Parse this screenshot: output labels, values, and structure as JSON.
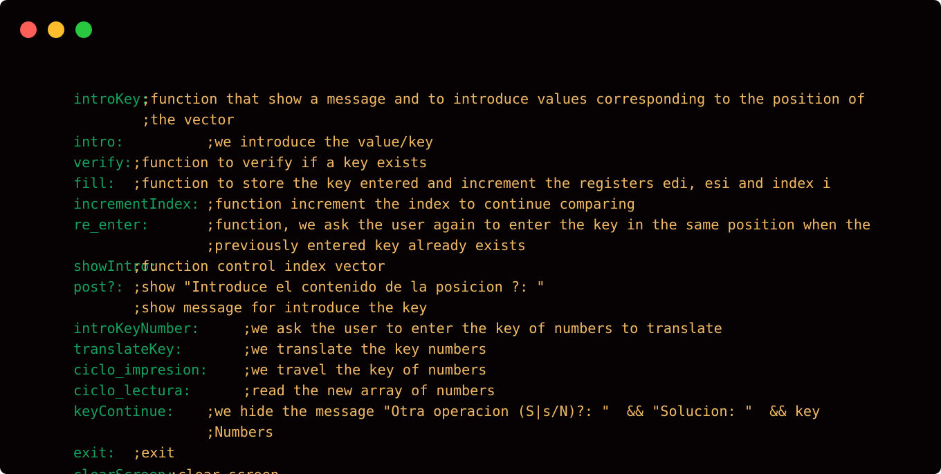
{
  "window": {
    "colors": {
      "background": "#060203",
      "label": "#14a05f",
      "comment": "#f0b864",
      "close": "#ff5f58",
      "minimize": "#ffbd2e",
      "maximize": "#28c940"
    }
  },
  "code": {
    "lines": [
      {
        "label": "introKey:",
        "comment": ";function that show a message and to introduce values corresponding to the position of"
      },
      {
        "label": "",
        "comment": ";the vector"
      },
      {
        "label": "intro:",
        "comment": ";we introduce the value/key"
      },
      {
        "label": "verify:",
        "comment": ";function to verify if a key exists"
      },
      {
        "label": "fill:",
        "comment": ";function to store the key entered and increment the registers edi, esi and index i"
      },
      {
        "label": "incrementIndex:",
        "comment": ";function increment the index to continue comparing"
      },
      {
        "label": "re_enter:",
        "comment": ";function, we ask the user again to enter the key in the same position when the"
      },
      {
        "label": "",
        "comment": ";previously entered key already exists"
      },
      {
        "label": "showIntro:",
        "comment": ";function control index vector"
      },
      {
        "label": "post?:",
        "comment": ";show \"Introduce el contenido de la posicion ?: \""
      },
      {
        "label": "",
        "comment": ";show message for introduce the key"
      },
      {
        "label": "introKeyNumber:",
        "comment": ";we ask the user to enter the key of numbers to translate"
      },
      {
        "label": "translateKey:",
        "comment": ";we translate the key numbers"
      },
      {
        "label": "ciclo_impresion:",
        "comment": ";we travel the key of numbers"
      },
      {
        "label": "ciclo_lectura:",
        "comment": ";read the new array of numbers"
      },
      {
        "label": "keyContinue:",
        "comment": ";we hide the message \"Otra operacion (S|s/N)?: \"  && \"Solucion: \"  && key"
      },
      {
        "label": "",
        "comment": ";Numbers"
      },
      {
        "label": "exit:",
        "comment": ";exit"
      },
      {
        "label": "clearScreen:",
        "comment": ";clear screen"
      }
    ]
  }
}
